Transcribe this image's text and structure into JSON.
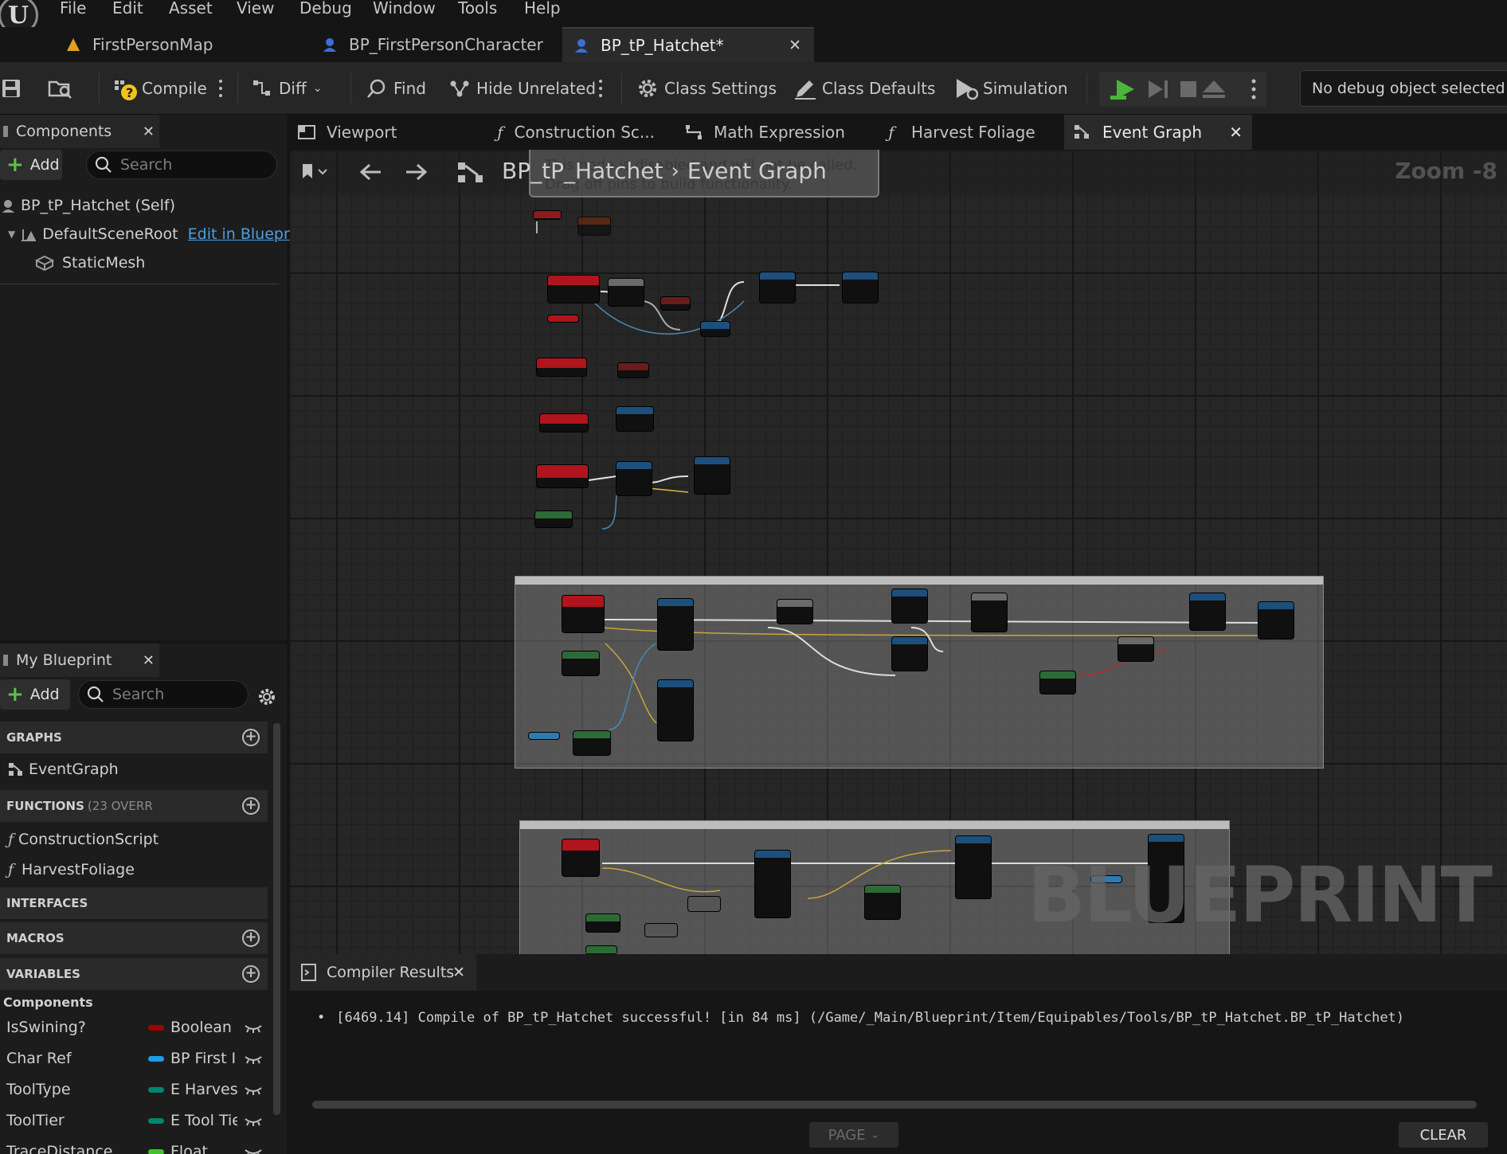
{
  "menu": [
    "File",
    "Edit",
    "Asset",
    "View",
    "Debug",
    "Window",
    "Tools",
    "Help"
  ],
  "doc_tabs": [
    {
      "label": "FirstPersonMap"
    },
    {
      "label": "BP_FirstPersonCharacter"
    },
    {
      "label": "BP_tP_Hatchet*",
      "active": true
    }
  ],
  "toolbar": {
    "compile": "Compile",
    "diff": "Diff",
    "find": "Find",
    "hide_unrelated": "Hide Unrelated",
    "class_settings": "Class Settings",
    "class_defaults": "Class Defaults",
    "simulation": "Simulation",
    "debug_object": "No debug object selected"
  },
  "components": {
    "tab_label": "Components",
    "add_label": "Add",
    "search_placeholder": "Search",
    "tree": {
      "self": "BP_tP_Hatchet (Self)",
      "root": "DefaultSceneRoot",
      "root_link": "Edit in Bluepr",
      "mesh": "StaticMesh"
    }
  },
  "my_blueprint": {
    "tab_label": "My Blueprint",
    "add_label": "Add",
    "search_placeholder": "Search",
    "sections": {
      "graphs": "GRAPHS",
      "functions": "FUNCTIONS",
      "functions_sub": "(23 OVERR",
      "interfaces": "INTERFACES",
      "macros": "MACROS",
      "variables": "VARIABLES"
    },
    "graphs": [
      "EventGraph"
    ],
    "functions": [
      "ConstructionScript",
      "HarvestFoliage"
    ],
    "variables_category": "Components",
    "variables": [
      {
        "name": "IsSwining?",
        "type": "Boolean",
        "color": "#a40000"
      },
      {
        "name": "Char Ref",
        "type": "BP First I",
        "color": "#1f9be8"
      },
      {
        "name": "ToolType",
        "type": "E Harves",
        "color": "#00876d"
      },
      {
        "name": "ToolTier",
        "type": "E Tool Tie",
        "color": "#00876d"
      },
      {
        "name": "TraceDistance",
        "type": "Float",
        "color": "#3fc22a"
      }
    ]
  },
  "graph_tabs": [
    {
      "label": "Viewport"
    },
    {
      "label": "Construction Sc..."
    },
    {
      "label": "Math Expression"
    },
    {
      "label": "Harvest Foliage"
    },
    {
      "label": "Event Graph",
      "active": true
    }
  ],
  "graph": {
    "breadcrumb_root": "BP_tP_Hatchet",
    "breadcrumb_leaf": "Event Graph",
    "zoom": "Zoom -8",
    "disabled_line1": "This node is disabled and will not be called.",
    "disabled_line2": "Drag off pins to build functionality.",
    "watermark": "BLUEPRINT"
  },
  "compiler": {
    "tab_label": "Compiler Results",
    "message": "[6469.14] Compile of BP_tP_Hatchet successful! [in 84 ms] (/Game/_Main/Blueprint/Item/Equipables/Tools/BP_tP_Hatchet.BP_tP_Hatchet)",
    "page_label": "PAGE",
    "clear_label": "CLEAR"
  },
  "colors": {
    "event_node": "#b0141c",
    "function_node": "#1d4f7c",
    "pure_node": "#2d6b36",
    "macro_node": "#6a6a6a",
    "link": "#4f9ee3",
    "play_green": "#4bb43a"
  }
}
